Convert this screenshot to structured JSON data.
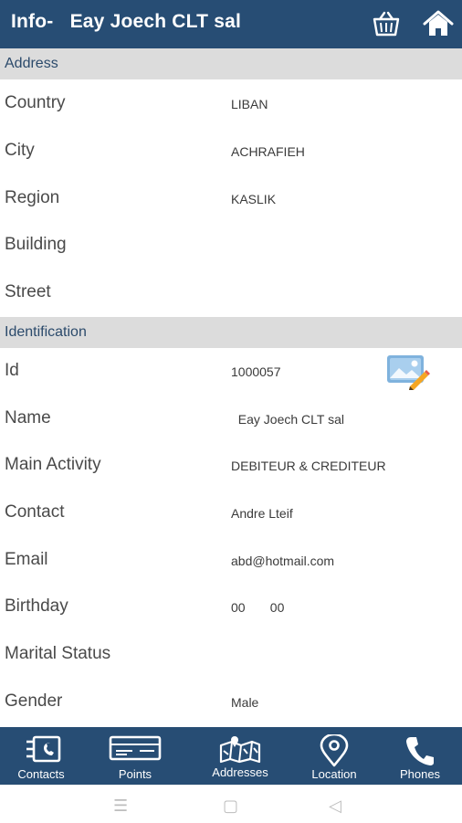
{
  "header": {
    "title": "Info-   Eay Joech CLT sal",
    "basket_icon": "basket-icon",
    "home_icon": "home-icon"
  },
  "address_section": {
    "title": "Address",
    "rows": [
      {
        "label": "Country",
        "value": "LIBAN"
      },
      {
        "label": "City",
        "value": "ACHRAFIEH"
      },
      {
        "label": "Region",
        "value": "KASLIK"
      },
      {
        "label": "Building",
        "value": ""
      },
      {
        "label": "Street",
        "value": ""
      }
    ]
  },
  "identification_section": {
    "title": "Identification",
    "rows": [
      {
        "label": "Id",
        "value": "1000057"
      },
      {
        "label": "Name",
        "value": "  Eay Joech CLT sal"
      },
      {
        "label": "Main Activity",
        "value": "DEBITEUR & CREDITEUR"
      },
      {
        "label": "Contact",
        "value": "Andre Lteif"
      },
      {
        "label": "Email",
        "value": "abd@hotmail.com"
      },
      {
        "label": "Birthday",
        "value": "00       00"
      },
      {
        "label": "Marital Status",
        "value": ""
      },
      {
        "label": "Gender",
        "value": "Male"
      }
    ],
    "edit_photo_icon": "edit-photo-icon"
  },
  "bottom_nav": {
    "items": [
      {
        "label": "Contacts",
        "icon": "contacts-icon"
      },
      {
        "label": "Points",
        "icon": "points-card-icon"
      },
      {
        "label": "Addresses",
        "icon": "map-icon"
      },
      {
        "label": "Location",
        "icon": "location-pin-icon"
      },
      {
        "label": "Phones",
        "icon": "phone-icon"
      }
    ]
  },
  "system_nav": {
    "menu_symbol": "☰",
    "home_symbol": "▢",
    "back_symbol": "◁"
  },
  "colors": {
    "primary": "#274d74",
    "section_bg": "#dcdcdc"
  }
}
